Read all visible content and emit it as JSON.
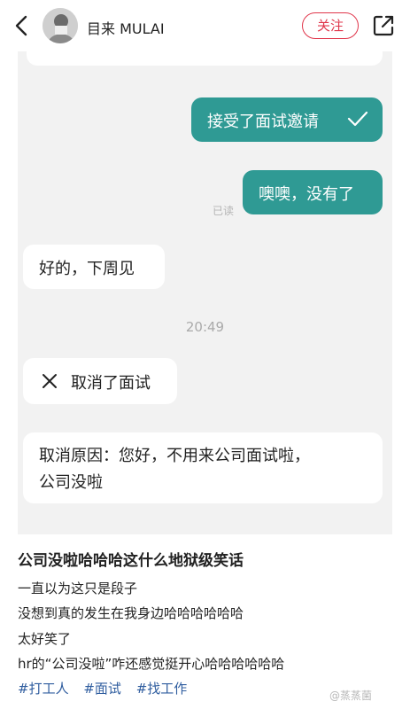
{
  "header": {
    "username": "目来 MULAI",
    "follow_label": "关注",
    "icons": {
      "back": "chevron-left-icon",
      "share": "share-icon"
    }
  },
  "chat": {
    "messages": [
      {
        "side": "right",
        "text": "接受了面试邀请",
        "icon": "check-icon"
      },
      {
        "side": "right",
        "text": "噢噢，没有了",
        "status": "已读"
      },
      {
        "side": "left",
        "text": "好的，下周见"
      }
    ],
    "time": "20:49",
    "cancel": {
      "text": "取消了面试",
      "icon": "close-icon"
    },
    "reason_line1": "取消原因：您好，不用来公司面试啦，",
    "reason_line2": "公司没啦"
  },
  "post": {
    "title": "公司没啦哈哈哈这什么地狱级笑话",
    "lines": [
      "一直以为这只是段子",
      "没想到真的发生在我身边哈哈哈哈哈哈",
      "太好笑了",
      "hr的“公司没啦”咋还感觉挺开心哈哈哈哈哈哈"
    ],
    "tags": [
      "#打工人",
      "#面试",
      "#找工作"
    ]
  },
  "watermark": "@蒸蒸菌",
  "colors": {
    "accent_teal": "#2f9a94",
    "follow_red": "#e0364b",
    "tag_blue": "#2f5d9f"
  }
}
